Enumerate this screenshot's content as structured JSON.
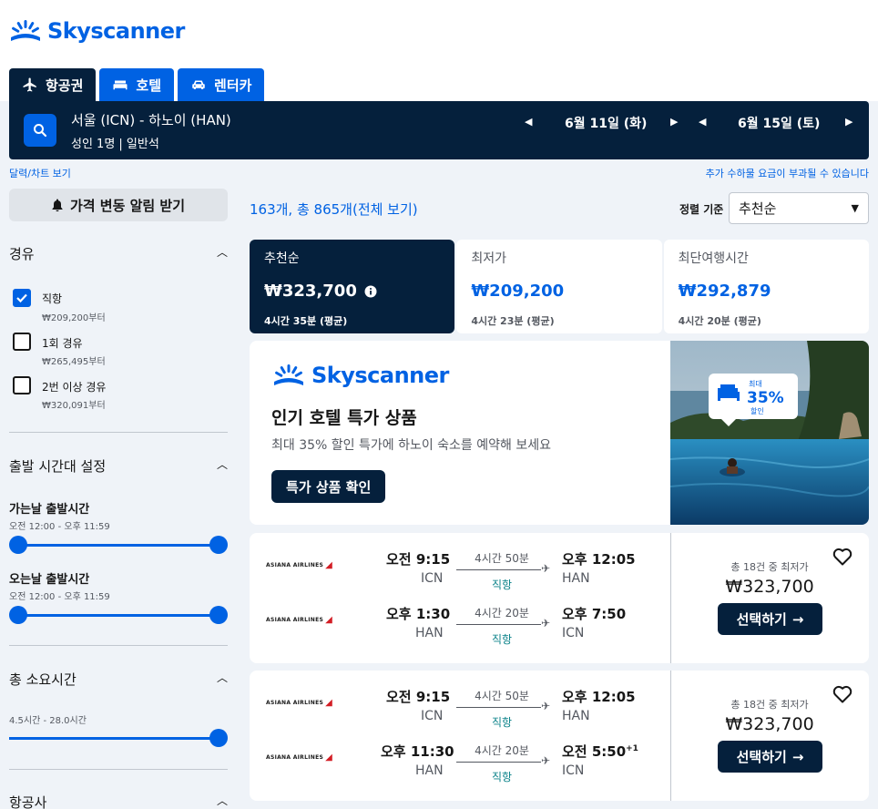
{
  "brand": {
    "name": "Skyscanner",
    "color": "#0062e3"
  },
  "tabs": [
    {
      "label": "항공권",
      "icon": "plane-icon",
      "active": true
    },
    {
      "label": "호텔",
      "icon": "bed-icon",
      "active": false
    },
    {
      "label": "렌터카",
      "icon": "car-icon",
      "active": false
    }
  ],
  "search": {
    "route": "서울 (ICN) - 하노이 (HAN)",
    "passengers": "성인 1명 | 일반석",
    "depart_date": "6월 11일 (화)",
    "return_date": "6월 15일 (토)"
  },
  "links": {
    "calendar": "달력/차트 보기",
    "fees": "추가 수하물 요금이 부과될 수 있습니다"
  },
  "sidebar": {
    "alert_button": "가격 변동 알림 받기",
    "stops": {
      "title": "경유",
      "options": [
        {
          "label": "직항",
          "price": "₩209,200부터",
          "checked": true
        },
        {
          "label": "1회 경유",
          "price": "₩265,495부터",
          "checked": false
        },
        {
          "label": "2번 이상 경유",
          "price": "₩320,091부터",
          "checked": false
        }
      ]
    },
    "times": {
      "title": "출발 시간대 설정",
      "outbound_label": "가는날 출발시간",
      "outbound_range": "오전 12:00 - 오후 11:59",
      "return_label": "오는날 출발시간",
      "return_range": "오전 12:00 - 오후 11:59"
    },
    "duration": {
      "title": "총 소요시간",
      "range": "4.5시간 - 28.0시간"
    },
    "airlines": {
      "title": "항공사"
    }
  },
  "results": {
    "count_text": "163개, 총 865개(전체 보기)",
    "sort_label": "정렬 기준",
    "sort_value": "추천순"
  },
  "sort_tabs": [
    {
      "title": "추천순",
      "price": "₩323,700",
      "duration": "4시간 35분 (평균)",
      "active": true
    },
    {
      "title": "최저가",
      "price": "₩209,200",
      "duration": "4시간 23분 (평균)",
      "active": false
    },
    {
      "title": "최단여행시간",
      "price": "₩292,879",
      "duration": "4시간 20분 (평균)",
      "active": false
    }
  ],
  "promo": {
    "title": "인기 호텔 특가 상품",
    "subtitle": "최대 35% 할인 특가에 하노이 숙소를 예약해 보세요",
    "button": "특가 상품 확인",
    "badge_top": "최대",
    "badge_pct": "35%",
    "badge_bottom": "할인"
  },
  "flights": [
    {
      "airline": "ASIANA AIRLINES",
      "legs": [
        {
          "dep_time": "오전 9:15",
          "dep_ap": "ICN",
          "duration": "4시간 50분",
          "stops": "직항",
          "arr_time": "오후 12:05",
          "arr_ap": "HAN",
          "plus": ""
        },
        {
          "dep_time": "오후 1:30",
          "dep_ap": "HAN",
          "duration": "4시간 20분",
          "stops": "직항",
          "arr_time": "오후 7:50",
          "arr_ap": "ICN",
          "plus": ""
        }
      ],
      "deals": "총 18건 중 최저가",
      "price": "₩323,700",
      "button": "선택하기"
    },
    {
      "airline": "ASIANA AIRLINES",
      "legs": [
        {
          "dep_time": "오전 9:15",
          "dep_ap": "ICN",
          "duration": "4시간 50분",
          "stops": "직항",
          "arr_time": "오후 12:05",
          "arr_ap": "HAN",
          "plus": ""
        },
        {
          "dep_time": "오후 11:30",
          "dep_ap": "HAN",
          "duration": "4시간 20분",
          "stops": "직항",
          "arr_time": "오전 5:50",
          "arr_ap": "ICN",
          "plus": "+1"
        }
      ],
      "deals": "총 18건 중 최저가",
      "price": "₩323,700",
      "button": "선택하기"
    }
  ]
}
